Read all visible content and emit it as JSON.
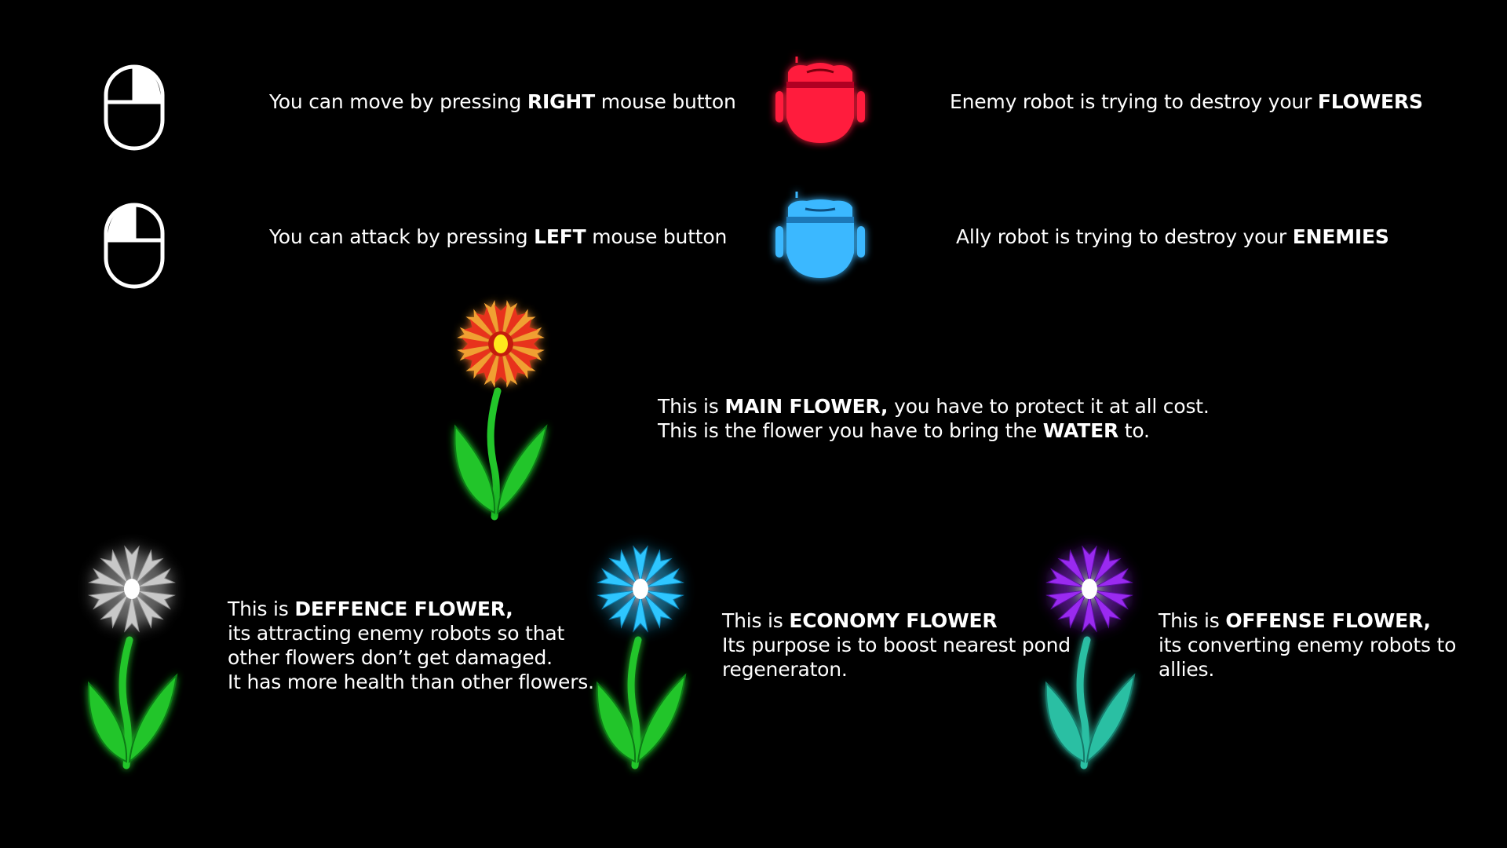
{
  "colors": {
    "background": "#000000",
    "text": "#ffffff",
    "enemy_robot": "#ff1a3c",
    "ally_robot": "#3ab8ff",
    "stem": "#22c52a",
    "main_flower": "#e8301c",
    "defence_flower": "#c8c8c8",
    "economy_flower": "#2ec6ff",
    "offense_flower": "#9a2cf0",
    "offense_leaves": "#2bbfa3"
  },
  "icons": {
    "right_mouse": "mouse-right-button-icon",
    "left_mouse": "mouse-left-button-icon",
    "enemy_robot": "enemy-robot-icon",
    "ally_robot": "ally-robot-icon",
    "main_flower": "main-flower-icon",
    "defence_flower": "defence-flower-icon",
    "economy_flower": "economy-flower-icon",
    "offense_flower": "offense-flower-icon"
  },
  "controls": {
    "move": {
      "pre": "You can move by pressing ",
      "bold": "RIGHT",
      "post": " mouse button"
    },
    "attack": {
      "pre": "You can attack by pressing ",
      "bold": "LEFT",
      "post": " mouse button"
    }
  },
  "robots": {
    "enemy": {
      "pre": "Enemy robot is trying to destroy your ",
      "bold": "FLOWERS"
    },
    "ally": {
      "pre": "Ally robot is trying to destroy your ",
      "bold": "ENEMIES"
    }
  },
  "main_flower": {
    "line1_pre": "This is ",
    "line1_bold": "MAIN FLOWER,",
    "line1_post": " you have to protect it at all cost.",
    "line2_pre": "This is the flower you have to bring the ",
    "line2_bold": "WATER",
    "line2_post": " to."
  },
  "defence_flower": {
    "pre": "This is ",
    "bold": "DEFFENCE FLOWER,",
    "line2": "its attracting enemy robots so that",
    "line3": "other flowers don’t get damaged.",
    "line4": "It has more health than other flowers."
  },
  "economy_flower": {
    "pre": "This is ",
    "bold": "ECONOMY FLOWER",
    "line2": "Its purpose is to boost nearest pond",
    "line3": "regeneraton."
  },
  "offense_flower": {
    "pre": "This is ",
    "bold": "OFFENSE FLOWER,",
    "line2": "its converting enemy robots to",
    "line3": "allies."
  }
}
